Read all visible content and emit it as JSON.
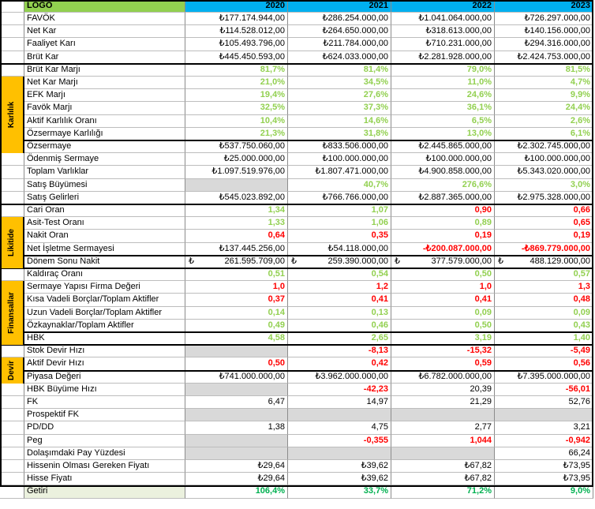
{
  "header": {
    "logo": "LOGO",
    "years": [
      "2020",
      "2021",
      "2022",
      "2023"
    ]
  },
  "categories": [
    {
      "label": "Karlılık",
      "start": 6,
      "end": 11,
      "color": "yellow"
    },
    {
      "label": "Likitide",
      "start": 17,
      "end": 20,
      "color": "yellow"
    },
    {
      "label": "Finansallar",
      "start": 22,
      "end": 26,
      "color": "yellow"
    },
    {
      "label": "Devir",
      "start": 28,
      "end": 29,
      "color": "yellow"
    }
  ],
  "rows": [
    {
      "label": "FAVÖK",
      "cells": [
        {
          "v": "₺177.174.944,00"
        },
        {
          "v": "₺286.254.000,00"
        },
        {
          "v": "₺1.041.064.000,00"
        },
        {
          "v": "₺726.297.000,00"
        }
      ]
    },
    {
      "label": "Net Kar",
      "cells": [
        {
          "v": "₺114.528.012,00"
        },
        {
          "v": "₺264.650.000,00"
        },
        {
          "v": "₺318.613.000,00"
        },
        {
          "v": "₺140.156.000,00"
        }
      ]
    },
    {
      "label": "Faaliyet Karı",
      "cells": [
        {
          "v": "₺105.493.796,00"
        },
        {
          "v": "₺211.784.000,00"
        },
        {
          "v": "₺710.231.000,00"
        },
        {
          "v": "₺294.316.000,00"
        }
      ]
    },
    {
      "label": "Brüt Kar",
      "cells": [
        {
          "v": "₺445.450.593,00"
        },
        {
          "v": "₺624.033.000,00"
        },
        {
          "v": "₺2.281.928.000,00"
        },
        {
          "v": "₺2.424.753.000,00"
        }
      ]
    },
    {
      "label": "Brüt Kar Marjı",
      "sep": true,
      "cells": [
        {
          "v": "81,7%",
          "c": "green"
        },
        {
          "v": "81,4%",
          "c": "green"
        },
        {
          "v": "79,0%",
          "c": "green"
        },
        {
          "v": "81,5%",
          "c": "green"
        }
      ]
    },
    {
      "label": "Net Kar Marjı",
      "cells": [
        {
          "v": "21,0%",
          "c": "green"
        },
        {
          "v": "34,5%",
          "c": "green"
        },
        {
          "v": "11,0%",
          "c": "green"
        },
        {
          "v": "4,7%",
          "c": "green"
        }
      ]
    },
    {
      "label": "EFK Marjı",
      "cells": [
        {
          "v": "19,4%",
          "c": "green"
        },
        {
          "v": "27,6%",
          "c": "green"
        },
        {
          "v": "24,6%",
          "c": "green"
        },
        {
          "v": "9,9%",
          "c": "green"
        }
      ]
    },
    {
      "label": "Favök Marjı",
      "cells": [
        {
          "v": "32,5%",
          "c": "green"
        },
        {
          "v": "37,3%",
          "c": "green"
        },
        {
          "v": "36,1%",
          "c": "green"
        },
        {
          "v": "24,4%",
          "c": "green"
        }
      ]
    },
    {
      "label": "Aktif Karlılık Oranı",
      "cells": [
        {
          "v": "10,4%",
          "c": "green"
        },
        {
          "v": "14,6%",
          "c": "green"
        },
        {
          "v": "6,5%",
          "c": "green"
        },
        {
          "v": "2,6%",
          "c": "green"
        }
      ]
    },
    {
      "label": "Özsermaye Karlılığı",
      "cells": [
        {
          "v": "21,3%",
          "c": "green"
        },
        {
          "v": "31,8%",
          "c": "green"
        },
        {
          "v": "13,0%",
          "c": "green"
        },
        {
          "v": "6,1%",
          "c": "green"
        }
      ]
    },
    {
      "label": "Özsermaye",
      "sep": true,
      "cells": [
        {
          "v": "₺537.750.060,00"
        },
        {
          "v": "₺833.506.000,00"
        },
        {
          "v": "₺2.445.865.000,00"
        },
        {
          "v": "₺2.302.745.000,00"
        }
      ]
    },
    {
      "label": "Ödenmiş Sermaye",
      "cells": [
        {
          "v": "₺25.000.000,00"
        },
        {
          "v": "₺100.000.000,00"
        },
        {
          "v": "₺100.000.000,00"
        },
        {
          "v": "₺100.000.000,00"
        }
      ]
    },
    {
      "label": "Toplam Varlıklar",
      "cells": [
        {
          "v": "₺1.097.519.976,00"
        },
        {
          "v": "₺1.807.471.000,00"
        },
        {
          "v": "₺4.900.858.000,00"
        },
        {
          "v": "₺5.343.020.000,00"
        }
      ]
    },
    {
      "label": "Satış Büyümesi",
      "cells": [
        {
          "v": "",
          "g": true
        },
        {
          "v": "40,7%",
          "c": "green"
        },
        {
          "v": "276,6%",
          "c": "green"
        },
        {
          "v": "3,0%",
          "c": "green"
        }
      ]
    },
    {
      "label": "Satış Gelirleri",
      "cells": [
        {
          "v": "₺545.023.892,00"
        },
        {
          "v": "₺766.766.000,00"
        },
        {
          "v": "₺2.887.365.000,00"
        },
        {
          "v": "₺2.975.328.000,00"
        }
      ]
    },
    {
      "label": "Cari Oran",
      "sep": true,
      "cells": [
        {
          "v": "1,34",
          "c": "green"
        },
        {
          "v": "1,07",
          "c": "green"
        },
        {
          "v": "0,90",
          "c": "red"
        },
        {
          "v": "0,66",
          "c": "red"
        }
      ]
    },
    {
      "label": "Asit-Test Oranı",
      "cells": [
        {
          "v": "1,33",
          "c": "green"
        },
        {
          "v": "1,06",
          "c": "green"
        },
        {
          "v": "0,89",
          "c": "green"
        },
        {
          "v": "0,65",
          "c": "red"
        }
      ]
    },
    {
      "label": "Nakit Oran",
      "cells": [
        {
          "v": "0,64",
          "c": "red"
        },
        {
          "v": "0,35",
          "c": "red"
        },
        {
          "v": "0,19",
          "c": "red"
        },
        {
          "v": "0,19",
          "c": "red"
        }
      ]
    },
    {
      "label": "Net İşletme Sermayesi",
      "cells": [
        {
          "v": "₺137.445.256,00"
        },
        {
          "v": "₺54.118.000,00"
        },
        {
          "v": "-₺200.087.000,00",
          "c": "red"
        },
        {
          "v": "-₺869.779.000,00",
          "c": "red"
        }
      ]
    },
    {
      "label": "Dönem Sonu Nakit",
      "sep": true,
      "lira": true,
      "cells": [
        {
          "v": "261.595.709,00"
        },
        {
          "v": "259.390.000,00"
        },
        {
          "v": "377.579.000,00"
        },
        {
          "v": "488.129.000,00"
        }
      ]
    },
    {
      "label": "Kaldıraç Oranı",
      "sep": true,
      "cells": [
        {
          "v": "0,51",
          "c": "green"
        },
        {
          "v": "0,54",
          "c": "green"
        },
        {
          "v": "0,50",
          "c": "green"
        },
        {
          "v": "0,57",
          "c": "green"
        }
      ]
    },
    {
      "label": "Sermaye Yapısı Firma Değeri",
      "cells": [
        {
          "v": "1,0",
          "c": "red"
        },
        {
          "v": "1,2",
          "c": "red"
        },
        {
          "v": "1,0",
          "c": "red"
        },
        {
          "v": "1,3",
          "c": "red"
        }
      ]
    },
    {
      "label": "Kısa Vadeli Borçlar/Toplam Aktifler",
      "cells": [
        {
          "v": "0,37",
          "c": "red"
        },
        {
          "v": "0,41",
          "c": "red"
        },
        {
          "v": "0,41",
          "c": "red"
        },
        {
          "v": "0,48",
          "c": "red"
        }
      ]
    },
    {
      "label": "Uzun Vadeli Borçlar/Toplam Aktifler",
      "cells": [
        {
          "v": "0,14",
          "c": "green"
        },
        {
          "v": "0,13",
          "c": "green"
        },
        {
          "v": "0,09",
          "c": "green"
        },
        {
          "v": "0,09",
          "c": "green"
        }
      ]
    },
    {
      "label": "Özkaynaklar/Toplam Aktifler",
      "cells": [
        {
          "v": "0,49",
          "c": "green"
        },
        {
          "v": "0,46",
          "c": "green"
        },
        {
          "v": "0,50",
          "c": "green"
        },
        {
          "v": "0,43",
          "c": "green"
        }
      ]
    },
    {
      "label": "HBK",
      "sep": true,
      "cells": [
        {
          "v": "4,58",
          "c": "green"
        },
        {
          "v": "2,65",
          "c": "green"
        },
        {
          "v": "3,19",
          "c": "green"
        },
        {
          "v": "1,40",
          "c": "green"
        }
      ]
    },
    {
      "label": "Stok Devir Hızı",
      "sep": true,
      "cells": [
        {
          "v": "",
          "g": true
        },
        {
          "v": "-8,13",
          "c": "red"
        },
        {
          "v": "-15,32",
          "c": "red"
        },
        {
          "v": "-5,49",
          "c": "red"
        }
      ]
    },
    {
      "label": "Aktif Devir Hızı",
      "cells": [
        {
          "v": "0,50",
          "c": "red"
        },
        {
          "v": "0,42",
          "c": "red"
        },
        {
          "v": "0,59",
          "c": "red"
        },
        {
          "v": "0,56",
          "c": "red"
        }
      ]
    },
    {
      "label": "Piyasa Değeri",
      "sep": true,
      "cells": [
        {
          "v": "₺741.000.000,00"
        },
        {
          "v": "₺3.962.000.000,00"
        },
        {
          "v": "₺6.782.000.000,00"
        },
        {
          "v": "₺7.395.000.000,00"
        }
      ]
    },
    {
      "label": "HBK Büyüme Hızı",
      "cells": [
        {
          "v": "",
          "g": true
        },
        {
          "v": "-42,23",
          "c": "red"
        },
        {
          "v": "20,39"
        },
        {
          "v": "-56,01",
          "c": "red"
        }
      ]
    },
    {
      "label": "FK",
      "cells": [
        {
          "v": "6,47"
        },
        {
          "v": "14,97"
        },
        {
          "v": "21,29"
        },
        {
          "v": "52,76"
        }
      ]
    },
    {
      "label": "Prospektif FK",
      "cells": [
        {
          "v": "",
          "g": true
        },
        {
          "v": "",
          "g": true
        },
        {
          "v": "",
          "g": true
        },
        {
          "v": "",
          "g": true
        }
      ]
    },
    {
      "label": "PD/DD",
      "cells": [
        {
          "v": "1,38"
        },
        {
          "v": "4,75"
        },
        {
          "v": "2,77"
        },
        {
          "v": "3,21"
        }
      ]
    },
    {
      "label": "Peg",
      "cells": [
        {
          "v": "",
          "g": true
        },
        {
          "v": "-0,355",
          "c": "red"
        },
        {
          "v": "1,044",
          "c": "red"
        },
        {
          "v": "-0,942",
          "c": "red"
        }
      ]
    },
    {
      "label": "Dolaşımdaki Pay Yüzdesi",
      "cells": [
        {
          "v": "",
          "g": true
        },
        {
          "v": "",
          "g": true
        },
        {
          "v": "",
          "g": true
        },
        {
          "v": "66,24"
        }
      ]
    },
    {
      "label": "Hissenin Olması Gereken Fiyatı",
      "cells": [
        {
          "v": "₺29,64"
        },
        {
          "v": "₺39,62"
        },
        {
          "v": "₺67,82"
        },
        {
          "v": "₺73,95"
        }
      ]
    },
    {
      "label": "Hisse Fiyatı",
      "cells": [
        {
          "v": "₺29,64"
        },
        {
          "v": "₺39,62"
        },
        {
          "v": "₺67,82"
        },
        {
          "v": "₺73,95"
        }
      ]
    },
    {
      "label": "Getiri",
      "lg": true,
      "cells": [
        {
          "v": "106,4%",
          "c": "darkgreen"
        },
        {
          "v": "33,7%",
          "c": "darkgreen"
        },
        {
          "v": "71,2%",
          "c": "darkgreen"
        },
        {
          "v": "9,0%",
          "c": "darkgreen"
        }
      ]
    }
  ],
  "colors": {
    "header_bg": "#00b0f0",
    "logo_bg": "#92d050",
    "category_bg": "#ffc000",
    "positive": "#92d050",
    "negative": "#ff0000",
    "return": "#00b050"
  },
  "lira_symbol": "₺"
}
